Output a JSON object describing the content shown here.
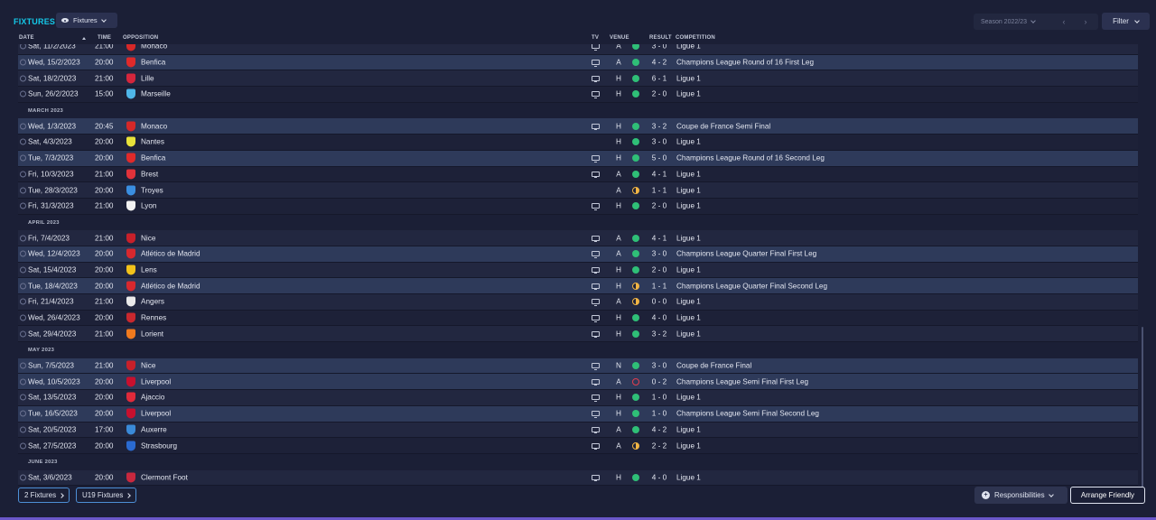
{
  "header": {
    "title": "FIXTURES",
    "view_dropdown": "Fixtures",
    "season": "Season 2022/23",
    "filter": "Filter"
  },
  "columns": {
    "date": "DATE",
    "time": "TIME",
    "opposition": "OPPOSITION",
    "tv": "TV",
    "venue": "VENUE",
    "result": "RESULT",
    "competition": "COMPETITION"
  },
  "rows": [
    {
      "date": "Sat, 11/2/2023",
      "time": "21:00",
      "team": "Monaco",
      "crest": "#d62828",
      "tv": true,
      "venue": "A",
      "outcome": "win",
      "result": "3 - 0",
      "competition": "Ligue 1",
      "hl": false
    },
    {
      "date": "Wed, 15/2/2023",
      "time": "20:00",
      "team": "Benfica",
      "crest": "#e02a2a",
      "tv": true,
      "venue": "A",
      "outcome": "win",
      "result": "4 - 2",
      "competition": "Champions League Round of 16  First Leg",
      "hl": true
    },
    {
      "date": "Sat, 18/2/2023",
      "time": "21:00",
      "team": "Lille",
      "crest": "#d5263c",
      "tv": true,
      "venue": "H",
      "outcome": "win",
      "result": "6 - 1",
      "competition": "Ligue 1",
      "hl": false
    },
    {
      "date": "Sun, 26/2/2023",
      "time": "15:00",
      "team": "Marseille",
      "crest": "#4fb6e8",
      "tv": true,
      "venue": "H",
      "outcome": "win",
      "result": "2 - 0",
      "competition": "Ligue 1",
      "hl": false
    },
    {
      "month": "MARCH 2023"
    },
    {
      "date": "Wed, 1/3/2023",
      "time": "20:45",
      "team": "Monaco",
      "crest": "#d62828",
      "tv": true,
      "venue": "H",
      "outcome": "win",
      "result": "3 - 2",
      "competition": "Coupe de France Semi Final",
      "hl": true
    },
    {
      "date": "Sat, 4/3/2023",
      "time": "20:00",
      "team": "Nantes",
      "crest": "#e8e23a",
      "tv": false,
      "venue": "H",
      "outcome": "win",
      "result": "3 - 0",
      "competition": "Ligue 1",
      "hl": false
    },
    {
      "date": "Tue, 7/3/2023",
      "time": "20:00",
      "team": "Benfica",
      "crest": "#e02a2a",
      "tv": true,
      "venue": "H",
      "outcome": "win",
      "result": "5 - 0",
      "competition": "Champions League Round of 16  Second Leg",
      "hl": true
    },
    {
      "date": "Fri, 10/3/2023",
      "time": "21:00",
      "team": "Brest",
      "crest": "#e0323a",
      "tv": true,
      "venue": "A",
      "outcome": "win",
      "result": "4 - 1",
      "competition": "Ligue 1",
      "hl": false
    },
    {
      "date": "Tue, 28/3/2023",
      "time": "20:00",
      "team": "Troyes",
      "crest": "#3a8ee0",
      "tv": false,
      "venue": "A",
      "outcome": "draw",
      "result": "1 - 1",
      "competition": "Ligue 1",
      "hl": false
    },
    {
      "date": "Fri, 31/3/2023",
      "time": "21:00",
      "team": "Lyon",
      "crest": "#f2f2f2",
      "tv": true,
      "venue": "H",
      "outcome": "win",
      "result": "2 - 0",
      "competition": "Ligue 1",
      "hl": false
    },
    {
      "month": "APRIL 2023"
    },
    {
      "date": "Fri, 7/4/2023",
      "time": "21:00",
      "team": "Nice",
      "crest": "#c8202a",
      "tv": true,
      "venue": "A",
      "outcome": "win",
      "result": "4 - 1",
      "competition": "Ligue 1",
      "hl": false
    },
    {
      "date": "Wed, 12/4/2023",
      "time": "20:00",
      "team": "Atlético de Madrid",
      "crest": "#d8282e",
      "tv": true,
      "venue": "A",
      "outcome": "win",
      "result": "3 - 0",
      "competition": "Champions League Quarter Final First Leg",
      "hl": true
    },
    {
      "date": "Sat, 15/4/2023",
      "time": "20:00",
      "team": "Lens",
      "crest": "#f2c21a",
      "tv": true,
      "venue": "H",
      "outcome": "win",
      "result": "2 - 0",
      "competition": "Ligue 1",
      "hl": false
    },
    {
      "date": "Tue, 18/4/2023",
      "time": "20:00",
      "team": "Atlético de Madrid",
      "crest": "#d8282e",
      "tv": true,
      "venue": "H",
      "outcome": "draw",
      "result": "1 - 1",
      "competition": "Champions League Quarter Final Second Leg",
      "hl": true
    },
    {
      "date": "Fri, 21/4/2023",
      "time": "21:00",
      "team": "Angers",
      "crest": "#eaeaea",
      "tv": true,
      "venue": "A",
      "outcome": "draw",
      "result": "0 - 0",
      "competition": "Ligue 1",
      "hl": false
    },
    {
      "date": "Wed, 26/4/2023",
      "time": "20:00",
      "team": "Rennes",
      "crest": "#c8282e",
      "tv": true,
      "venue": "H",
      "outcome": "win",
      "result": "4 - 0",
      "competition": "Ligue 1",
      "hl": false
    },
    {
      "date": "Sat, 29/4/2023",
      "time": "21:00",
      "team": "Lorient",
      "crest": "#f07a1e",
      "tv": true,
      "venue": "H",
      "outcome": "win",
      "result": "3 - 2",
      "competition": "Ligue 1",
      "hl": false
    },
    {
      "month": "MAY 2023"
    },
    {
      "date": "Sun, 7/5/2023",
      "time": "21:00",
      "team": "Nice",
      "crest": "#c8202a",
      "tv": true,
      "venue": "N",
      "outcome": "win",
      "result": "3 - 0",
      "competition": "Coupe de France Final",
      "hl": true
    },
    {
      "date": "Wed, 10/5/2023",
      "time": "20:00",
      "team": "Liverpool",
      "crest": "#c8102e",
      "tv": true,
      "venue": "A",
      "outcome": "loss",
      "result": "0 - 2",
      "competition": "Champions League Semi Final First Leg",
      "hl": true
    },
    {
      "date": "Sat, 13/5/2023",
      "time": "20:00",
      "team": "Ajaccio",
      "crest": "#e02a3a",
      "tv": true,
      "venue": "H",
      "outcome": "win",
      "result": "1 - 0",
      "competition": "Ligue 1",
      "hl": false
    },
    {
      "date": "Tue, 16/5/2023",
      "time": "20:00",
      "team": "Liverpool",
      "crest": "#c8102e",
      "tv": true,
      "venue": "H",
      "outcome": "win",
      "result": "1 - 0",
      "competition": "Champions League Semi Final Second Leg",
      "hl": true
    },
    {
      "date": "Sat, 20/5/2023",
      "time": "17:00",
      "team": "Auxerre",
      "crest": "#3a8ad8",
      "tv": true,
      "venue": "A",
      "outcome": "win",
      "result": "4 - 2",
      "competition": "Ligue 1",
      "hl": false
    },
    {
      "date": "Sat, 27/5/2023",
      "time": "20:00",
      "team": "Strasbourg",
      "crest": "#2a6ad0",
      "tv": true,
      "venue": "A",
      "outcome": "draw",
      "result": "2 - 2",
      "competition": "Ligue 1",
      "hl": false
    },
    {
      "month": "JUNE 2023"
    },
    {
      "date": "Sat, 3/6/2023",
      "time": "20:00",
      "team": "Clermont Foot",
      "crest": "#c8283e",
      "tv": true,
      "venue": "H",
      "outcome": "win",
      "result": "4 - 0",
      "competition": "Ligue 1",
      "hl": false
    }
  ],
  "footer": {
    "fixtures_link": "2 Fixtures",
    "u19_link": "U19 Fixtures",
    "responsibilities": "Responsibilities",
    "arrange": "Arrange Friendly"
  },
  "colors": {
    "accent": "#14c8e8",
    "win": "#2fbf77",
    "draw": "#f0b444",
    "loss": "#e23d4e",
    "highlight_row": "#2e3a5a"
  }
}
